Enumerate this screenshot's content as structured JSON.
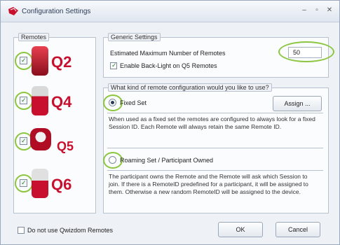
{
  "window": {
    "title": "Configuration Settings",
    "controls": {
      "minimize": "–",
      "restore": "▫",
      "close": "✕"
    }
  },
  "remotes_group": {
    "label": "Remotes",
    "items": [
      {
        "label": "Q2",
        "checked": true,
        "color": "#c8102e"
      },
      {
        "label": "Q4",
        "checked": true,
        "color": "#c8102e"
      },
      {
        "label": "Q5",
        "checked": true,
        "color": "#c8102e"
      },
      {
        "label": "Q6",
        "checked": true,
        "color": "#c8102e"
      }
    ]
  },
  "generic_settings": {
    "label": "Generic Settings",
    "max_remotes_label": "Estimated Maximum Number of Remotes",
    "max_remotes_value": "50",
    "backlight_label": "Enable Back-Light on Q5 Remotes",
    "backlight_checked": true
  },
  "config_group": {
    "label": "What kind of remote configuration would you like to use?",
    "fixed": {
      "label": "Fixed Set",
      "selected": true,
      "assign_button": "Assign ...",
      "description": "When used as a fixed set the remotes are configured to always look for a fixed Session ID. Each Remote will always retain the same Remote ID."
    },
    "roaming": {
      "label": "Roaming Set / Participant Owned",
      "selected": false,
      "description": "The participant owns the Remote and the Remote will ask which Session to join. If there is a RemoteID predefined for a participant, it will be assigned to them. Otherwise a new random RemoteID will be assigned to the device."
    }
  },
  "footer": {
    "no_remotes_label": "Do not use Qwizdom Remotes",
    "ok_button": "OK",
    "cancel_button": "Cancel"
  },
  "colors": {
    "highlight": "#8cc63f",
    "brand": "#c8102e"
  }
}
